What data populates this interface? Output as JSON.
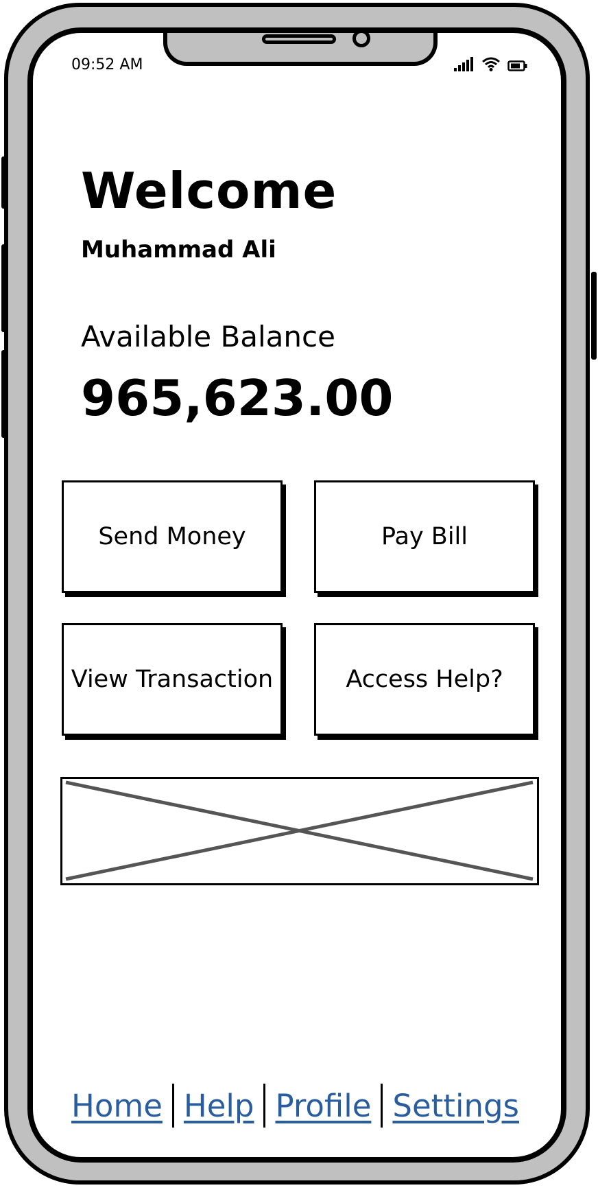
{
  "status_bar": {
    "time": "09:52 AM",
    "icons": [
      "signal-icon",
      "wifi-icon",
      "battery-icon"
    ]
  },
  "header": {
    "title": "Welcome",
    "user_name": "Muhammad Ali"
  },
  "balance": {
    "label": "Available Balance",
    "value": "965,623.00"
  },
  "actions": {
    "send_money": "Send Money",
    "pay_bill": "Pay Bill",
    "view_transaction": "View Transaction",
    "access_help": "Access Help?"
  },
  "bottom_nav": {
    "home": "Home",
    "help": "Help",
    "profile": "Profile",
    "settings": "Settings"
  },
  "colors": {
    "frame": "#c0c0c0",
    "link": "#2a5d9e",
    "placeholder_cross": "#555555"
  }
}
